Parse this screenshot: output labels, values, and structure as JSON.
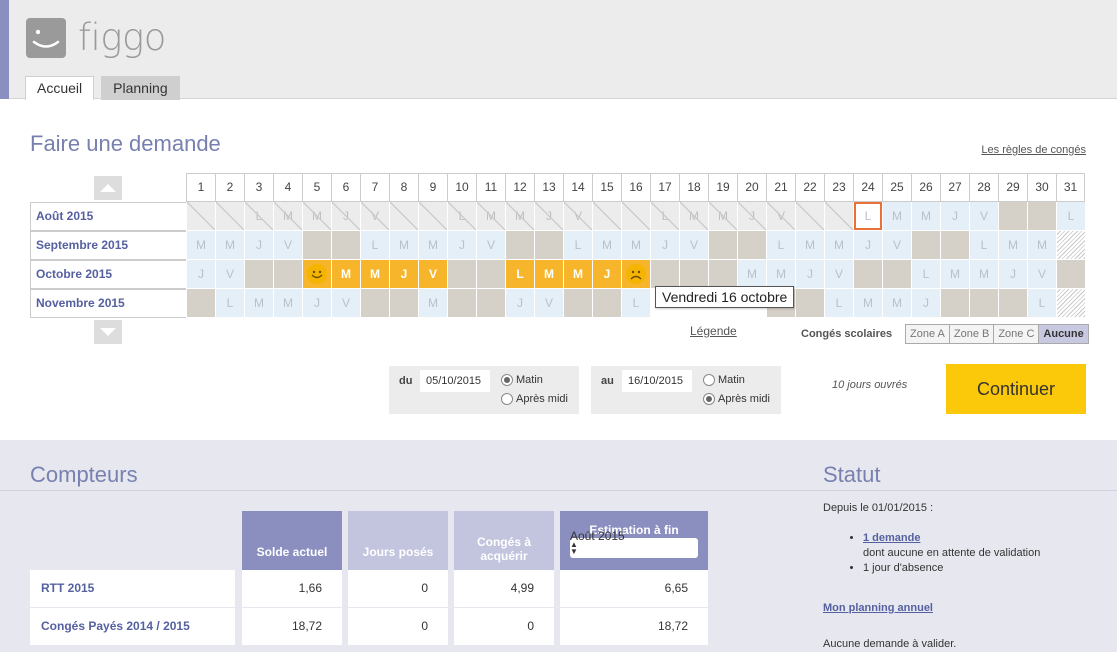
{
  "app": {
    "logo_text": "figgo",
    "accent_color": "#8b8fbf",
    "brand_yellow": "#fcc80a"
  },
  "tabs": [
    {
      "label": "Accueil",
      "active": true
    },
    {
      "label": "Planning",
      "active": false
    }
  ],
  "demande": {
    "title": "Faire une demande",
    "regles_link": "Les règles de congés",
    "days": [
      "1",
      "2",
      "3",
      "4",
      "5",
      "6",
      "7",
      "8",
      "9",
      "10",
      "11",
      "12",
      "13",
      "14",
      "15",
      "16",
      "17",
      "18",
      "19",
      "20",
      "21",
      "22",
      "23",
      "24",
      "25",
      "26",
      "27",
      "28",
      "29",
      "30",
      "31"
    ],
    "months": [
      {
        "label": "Août 2015",
        "cells": [
          [
            "",
            "past"
          ],
          [
            "",
            "past"
          ],
          [
            "L",
            "past"
          ],
          [
            "M",
            "past"
          ],
          [
            "M",
            "past"
          ],
          [
            "J",
            "past"
          ],
          [
            "V",
            "past"
          ],
          [
            "",
            "past"
          ],
          [
            "",
            "past"
          ],
          [
            "L",
            "past"
          ],
          [
            "M",
            "past"
          ],
          [
            "M",
            "past"
          ],
          [
            "J",
            "past"
          ],
          [
            "V",
            "past"
          ],
          [
            "",
            "past"
          ],
          [
            "",
            "past"
          ],
          [
            "L",
            "past"
          ],
          [
            "M",
            "past"
          ],
          [
            "M",
            "past"
          ],
          [
            "J",
            "past"
          ],
          [
            "V",
            "past"
          ],
          [
            "",
            "past"
          ],
          [
            "",
            "past"
          ],
          [
            "L",
            "today"
          ],
          [
            "M",
            ""
          ],
          [
            "M",
            ""
          ],
          [
            "J",
            ""
          ],
          [
            "V",
            ""
          ],
          [
            "",
            "we"
          ],
          [
            "",
            "we"
          ],
          [
            "L",
            ""
          ]
        ]
      },
      {
        "label": "Septembre 2015",
        "cells": [
          [
            "M",
            ""
          ],
          [
            "M",
            ""
          ],
          [
            "J",
            ""
          ],
          [
            "V",
            ""
          ],
          [
            "",
            "we"
          ],
          [
            "",
            "we"
          ],
          [
            "L",
            ""
          ],
          [
            "M",
            ""
          ],
          [
            "M",
            ""
          ],
          [
            "J",
            ""
          ],
          [
            "V",
            ""
          ],
          [
            "",
            "we"
          ],
          [
            "",
            "we"
          ],
          [
            "L",
            ""
          ],
          [
            "M",
            ""
          ],
          [
            "M",
            ""
          ],
          [
            "J",
            ""
          ],
          [
            "V",
            ""
          ],
          [
            "",
            "we"
          ],
          [
            "",
            "we"
          ],
          [
            "L",
            ""
          ],
          [
            "M",
            ""
          ],
          [
            "M",
            ""
          ],
          [
            "J",
            ""
          ],
          [
            "V",
            ""
          ],
          [
            "",
            "we"
          ],
          [
            "",
            "we"
          ],
          [
            "L",
            ""
          ],
          [
            "M",
            ""
          ],
          [
            "M",
            ""
          ],
          [
            "",
            "hatch"
          ]
        ]
      },
      {
        "label": "Octobre 2015",
        "cells": [
          [
            "J",
            ""
          ],
          [
            "V",
            ""
          ],
          [
            "",
            "we"
          ],
          [
            "",
            "we"
          ],
          [
            "smile",
            "selected"
          ],
          [
            "M",
            "selected"
          ],
          [
            "M",
            "selected"
          ],
          [
            "J",
            "selected"
          ],
          [
            "V",
            "selected"
          ],
          [
            "",
            "we"
          ],
          [
            "",
            "we"
          ],
          [
            "L",
            "selected"
          ],
          [
            "M",
            "selected"
          ],
          [
            "M",
            "selected"
          ],
          [
            "J",
            "selected"
          ],
          [
            "sad",
            "selected"
          ],
          [
            "",
            "we"
          ],
          [
            "",
            "we"
          ],
          [
            "",
            "we"
          ],
          [
            "M",
            ""
          ],
          [
            "M",
            ""
          ],
          [
            "J",
            ""
          ],
          [
            "V",
            ""
          ],
          [
            "",
            "we"
          ],
          [
            "",
            "we"
          ],
          [
            "L",
            ""
          ],
          [
            "M",
            ""
          ],
          [
            "M",
            ""
          ],
          [
            "J",
            ""
          ],
          [
            "V",
            ""
          ],
          [
            "",
            "we"
          ]
        ]
      },
      {
        "label": "Novembre 2015",
        "cells": [
          [
            "",
            "we"
          ],
          [
            "L",
            ""
          ],
          [
            "M",
            ""
          ],
          [
            "M",
            ""
          ],
          [
            "J",
            ""
          ],
          [
            "V",
            ""
          ],
          [
            "",
            "we"
          ],
          [
            "",
            "we"
          ],
          [
            "M",
            ""
          ],
          [
            "",
            "we"
          ],
          [
            "",
            "we"
          ],
          [
            "J",
            ""
          ],
          [
            "V",
            ""
          ],
          [
            "",
            "we"
          ],
          [
            "",
            "we"
          ],
          [
            "L",
            ""
          ],
          [
            "",
            "na"
          ],
          [
            "",
            "na"
          ],
          [
            "",
            "na"
          ],
          [
            "",
            "na"
          ],
          [
            "",
            "we"
          ],
          [
            "",
            "we"
          ],
          [
            "L",
            ""
          ],
          [
            "M",
            ""
          ],
          [
            "M",
            ""
          ],
          [
            "J",
            ""
          ],
          [
            "",
            "we"
          ],
          [
            "",
            "we"
          ],
          [
            "",
            "we"
          ],
          [
            "L",
            ""
          ],
          [
            "",
            "hatch"
          ]
        ]
      }
    ],
    "tooltip": "Vendredi 16 octobre",
    "legende": "Légende",
    "conges_scolaires": "Congés scolaires",
    "zones": [
      "Zone A",
      "Zone B",
      "Zone C",
      "Aucune"
    ],
    "du": {
      "label": "du",
      "date": "05/10/2015",
      "opt1": "Matin",
      "opt2": "Après midi",
      "selected": "Matin"
    },
    "au": {
      "label": "au",
      "date": "16/10/2015",
      "opt1": "Matin",
      "opt2": "Après midi",
      "selected": "Après midi"
    },
    "jours_ouvres": "10 jours ouvrés",
    "continuer": "Continuer"
  },
  "compteurs": {
    "title": "Compteurs",
    "headers": [
      "Solde actuel",
      "Jours posés",
      "Congés à acquérir",
      "Estimation à fin"
    ],
    "estimation_select": "Août 2015",
    "rows": [
      {
        "label": "RTT 2015",
        "values": [
          "1,66",
          "0",
          "4,99",
          "6,65"
        ]
      },
      {
        "label": "Congés Payés 2014 / 2015",
        "values": [
          "18,72",
          "0",
          "0",
          "18,72"
        ]
      }
    ]
  },
  "statut": {
    "title": "Statut",
    "depuis": "Depuis le 01/01/2015 :",
    "demande_link": "1 demande",
    "attente": "dont aucune en attente de validation",
    "absence": "1 jour d'absence",
    "planning_link": "Mon planning annuel",
    "aucune": "Aucune demande à valider."
  }
}
